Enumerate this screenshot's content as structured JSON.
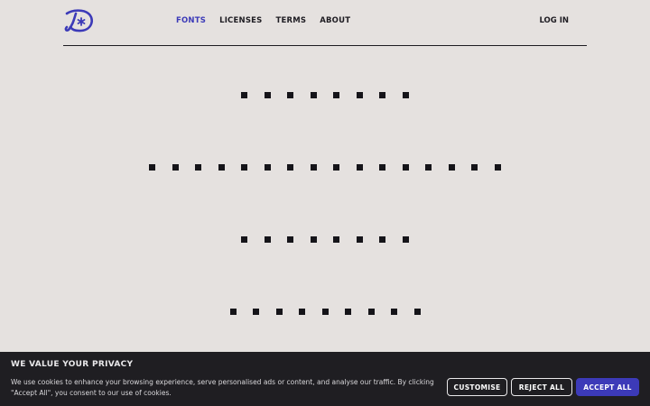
{
  "logo": {
    "icon": "type-logo-icon",
    "color": "#3c3ab8"
  },
  "nav": {
    "items": [
      {
        "label": "FONTS",
        "active": true
      },
      {
        "label": "LICENSES",
        "active": false
      },
      {
        "label": "TERMS",
        "active": false
      },
      {
        "label": "ABOUT",
        "active": false
      }
    ],
    "login_label": "LOG IN"
  },
  "rows": [
    8,
    16,
    8,
    9
  ],
  "cookie": {
    "title": "WE VALUE YOUR PRIVACY",
    "text": "We use cookies to enhance your browsing experience, serve personalised ads or content, and analyse our traffic. By clicking \"Accept All\", you consent to our use of cookies.",
    "customise_label": "CUSTOMISE",
    "reject_label": "REJECT ALL",
    "accept_label": "ACCEPT ALL"
  },
  "colors": {
    "accent": "#3c3ab8",
    "ink": "#151419",
    "background": "#e5e1df",
    "banner": "#1f1e22"
  }
}
